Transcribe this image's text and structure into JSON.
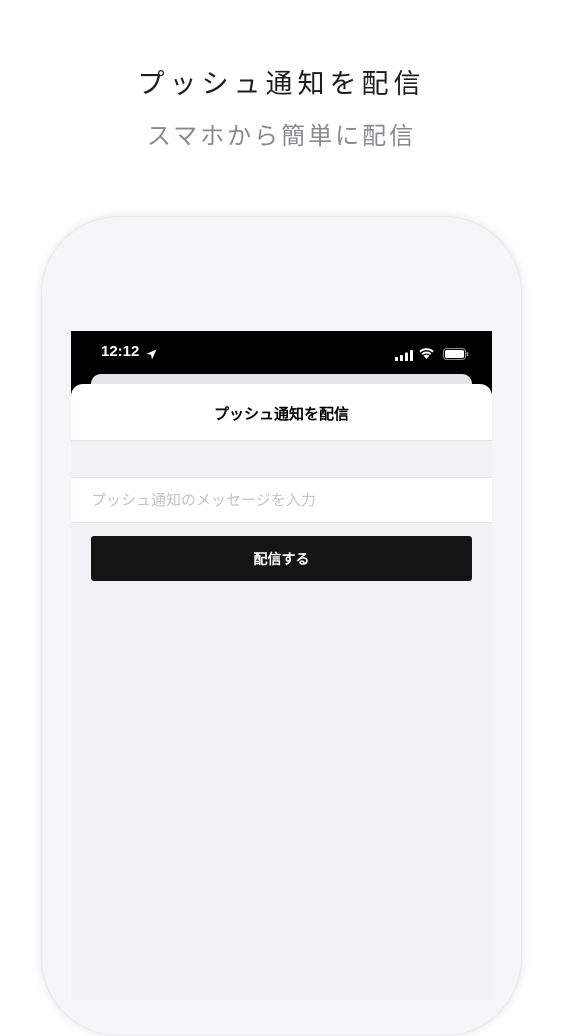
{
  "promo": {
    "headline": "プッシュ通知を配信",
    "subheadline": "スマホから簡単に配信"
  },
  "status_bar": {
    "time": "12:12",
    "icons": [
      "location-arrow-icon",
      "signal-icon",
      "wifi-icon",
      "battery-icon"
    ]
  },
  "screen": {
    "title": "プッシュ通知を配信",
    "message_input": {
      "value": "",
      "placeholder": "プッシュ通知のメッセージを入力"
    },
    "send_button_label": "配信する"
  },
  "colors": {
    "button_background": "#141414",
    "screen_background": "#f2f1f6",
    "status_bar_background": "#000000"
  }
}
